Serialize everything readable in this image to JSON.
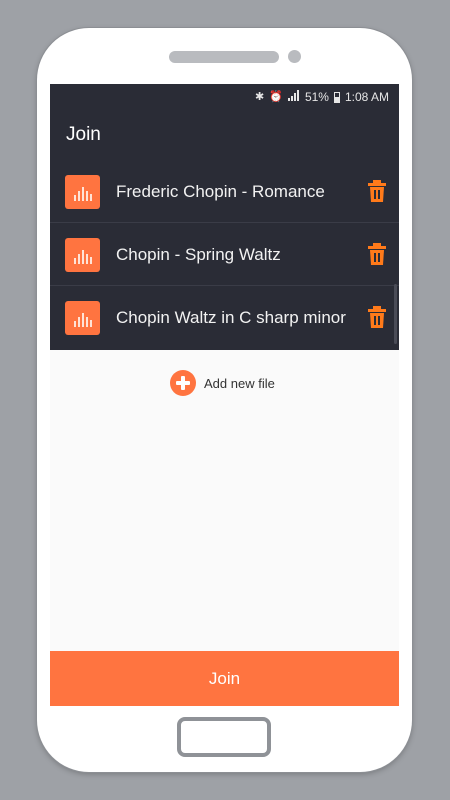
{
  "status_bar": {
    "icons": [
      "bluetooth-icon",
      "alarm-icon",
      "signal-icon",
      "battery-icon"
    ],
    "battery_percent": "51%",
    "time": "1:08 AM"
  },
  "appbar": {
    "title": "Join"
  },
  "files": [
    {
      "name": "Frederic Chopin - Romance"
    },
    {
      "name": "Chopin - Spring Waltz"
    },
    {
      "name": "Chopin Waltz in C sharp minor"
    }
  ],
  "add_file": {
    "label": "Add new file"
  },
  "join_button": {
    "label": "Join"
  },
  "colors": {
    "accent": "#ff7440",
    "dark_bg": "#2a2c36",
    "content_bg": "#fafafa"
  }
}
